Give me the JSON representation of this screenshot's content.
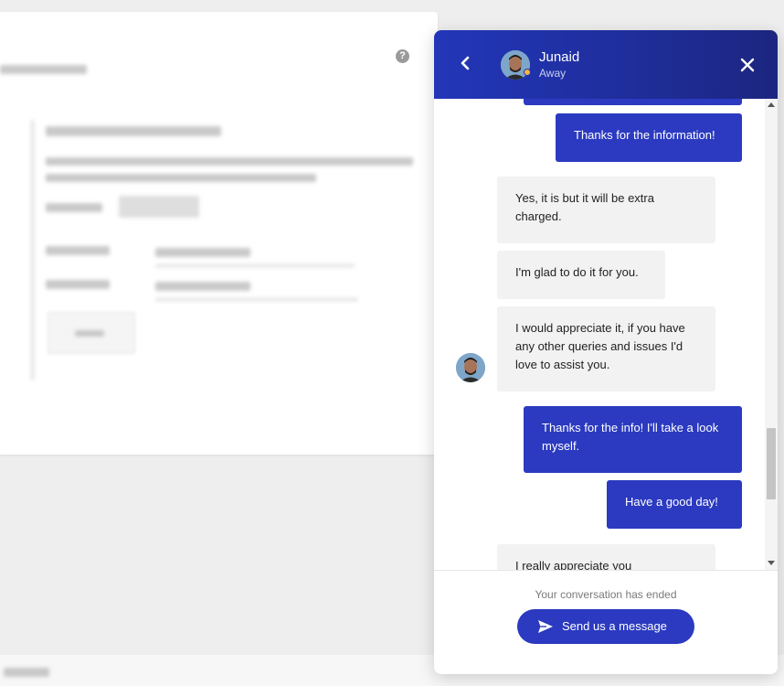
{
  "background_page": {
    "help_icon": "?"
  },
  "chat": {
    "header": {
      "agent_name": "Junaid",
      "agent_status": "Away",
      "back_icon": "chevron-left-icon",
      "close_icon": "close-icon",
      "status_color": "#f5b53d"
    },
    "messages": [
      {
        "from": "visitor",
        "text": "Thanks for the information!"
      },
      {
        "from": "agent",
        "text": "Yes, it is but it will be extra charged."
      },
      {
        "from": "agent",
        "text": "I'm glad to do it for you."
      },
      {
        "from": "agent",
        "text": "I would appreciate it, if you have any other queries and issues I'd love to assist you."
      },
      {
        "from": "visitor",
        "text": "Thanks for the info! I'll take a look myself."
      },
      {
        "from": "visitor",
        "text": "Have a good day!"
      },
      {
        "from": "agent",
        "text": "I really appreciate you"
      }
    ],
    "footer": {
      "ended_text": "Your conversation has ended",
      "send_label": "Send us a message",
      "send_icon": "paper-plane-icon"
    },
    "colors": {
      "accent": "#2b3ac0",
      "header_gradient_start": "#2236b8",
      "header_gradient_end": "#1c2680",
      "incoming_bubble": "#f2f2f2"
    }
  }
}
